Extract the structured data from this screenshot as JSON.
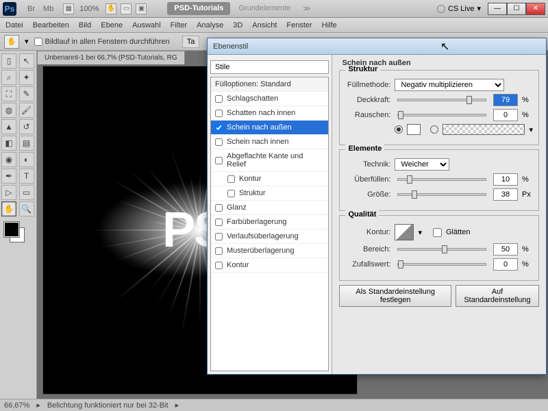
{
  "titlebar": {
    "logo": "Ps",
    "tabs": {
      "br": "Br",
      "mb": "Mb"
    },
    "zoom": "100%",
    "active_doc": "PSD-Tutorials",
    "other_doc": "Grundelemente",
    "chev": "≫",
    "cslive": "CS Live"
  },
  "menu": {
    "datei": "Datei",
    "bearbeiten": "Bearbeiten",
    "bild": "Bild",
    "ebene": "Ebene",
    "auswahl": "Auswahl",
    "filter": "Filter",
    "analyse": "Analyse",
    "dreid": "3D",
    "ansicht": "Ansicht",
    "fenster": "Fenster",
    "hilfe": "Hilfe"
  },
  "optbar": {
    "scroll_all": "Bildlauf in allen Fenstern durchführen",
    "ta": "Ta"
  },
  "doc": {
    "tab": "Unbenannt-1 bei 66,7% (PSD-Tutorials, RG",
    "text": "PSI"
  },
  "dialog": {
    "title": "Ebenenstil",
    "styles_head": "Stile",
    "items": {
      "fill": "Fülloptionen: Standard",
      "schlag": "Schlagschatten",
      "innen_schatten": "Schatten nach innen",
      "outer_glow": "Schein nach außen",
      "inner_glow": "Schein nach innen",
      "bevel": "Abgeflachte Kante und Relief",
      "kontur_sub": "Kontur",
      "struktur_sub": "Struktur",
      "glanz": "Glanz",
      "farb": "Farbüberlagerung",
      "verlauf": "Verlaufsüberlagerung",
      "muster": "Musterüberlagerung",
      "kontur": "Kontur"
    },
    "section_title": "Schein nach außen",
    "struktur": {
      "title": "Struktur",
      "blend_label": "Füllmethode:",
      "blend_value": "Negativ multiplizieren",
      "opacity_label": "Deckkraft:",
      "opacity_value": "79",
      "noise_label": "Rauschen:",
      "noise_value": "0"
    },
    "elemente": {
      "title": "Elemente",
      "technik_label": "Technik:",
      "technik_value": "Weicher",
      "spread_label": "Überfüllen:",
      "spread_value": "10",
      "size_label": "Größe:",
      "size_value": "38",
      "px": "Px"
    },
    "qualitaet": {
      "title": "Qualität",
      "kontur_label": "Kontur:",
      "glaetten": "Glätten",
      "bereich_label": "Bereich:",
      "bereich_value": "50",
      "jitter_label": "Zufallswert:",
      "jitter_value": "0"
    },
    "pct": "%",
    "btn_default": "Als Standardeinstellung festlegen",
    "btn_reset": "Auf Standardeinstellung"
  },
  "status": {
    "zoom": "66,67%",
    "msg": "Belichtung funktioniert nur bei 32-Bit"
  }
}
